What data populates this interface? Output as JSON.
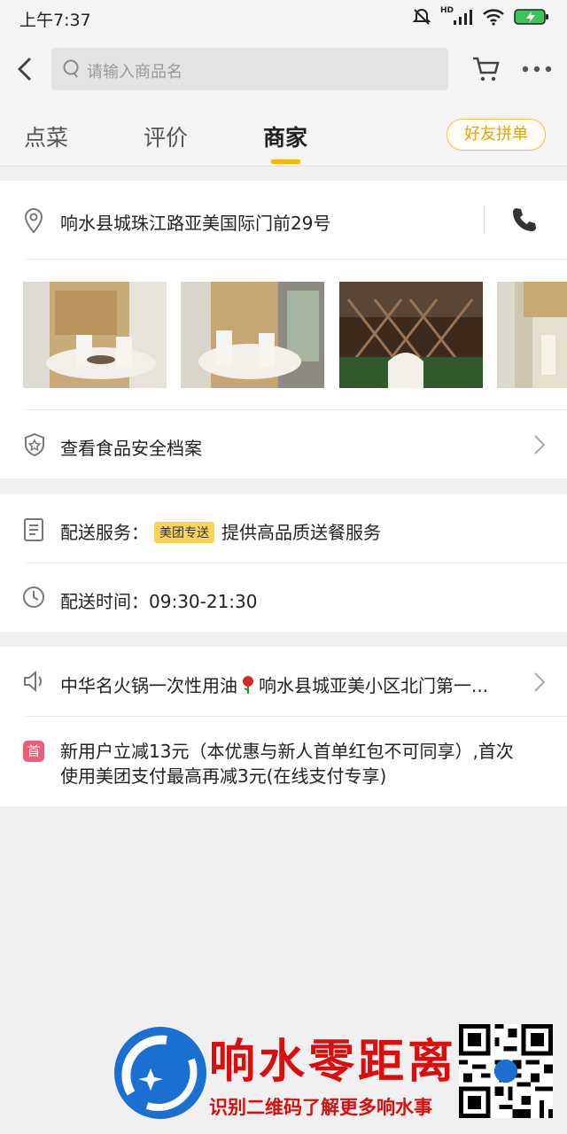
{
  "status": {
    "time": "上午7:37",
    "network": "HD"
  },
  "search": {
    "placeholder": "请输入商品名"
  },
  "tabs": [
    {
      "label": "点菜"
    },
    {
      "label": "评价"
    },
    {
      "label": "商家"
    }
  ],
  "friend_order": "好友拼单",
  "merchant": {
    "address": "响水县城珠江路亚美国际门前29号",
    "food_safety": "查看食品安全档案"
  },
  "delivery": {
    "service_label": "配送服务：",
    "service_badge": "美团专送",
    "service_desc": "提供高品质送餐服务",
    "time_label": "配送时间：",
    "time_value": "09:30-21:30"
  },
  "notices": {
    "announcement_before": "中华名火锅一次性用油",
    "announcement_after": "响水县城亚美小区北门第一...",
    "promo_icon": "首",
    "promo_line1": "新用户立减13元（本优惠与新人首单红包不可同享）,首次",
    "promo_line2": "使用美团支付最高再减3元(在线支付专享)"
  },
  "watermark": {
    "title": "响水零距离",
    "subtitle": "识别二维码了解更多响水事"
  },
  "colors": {
    "accent": "#f5b800",
    "promo": "#f05b7a",
    "badge": "#fcd25c"
  }
}
